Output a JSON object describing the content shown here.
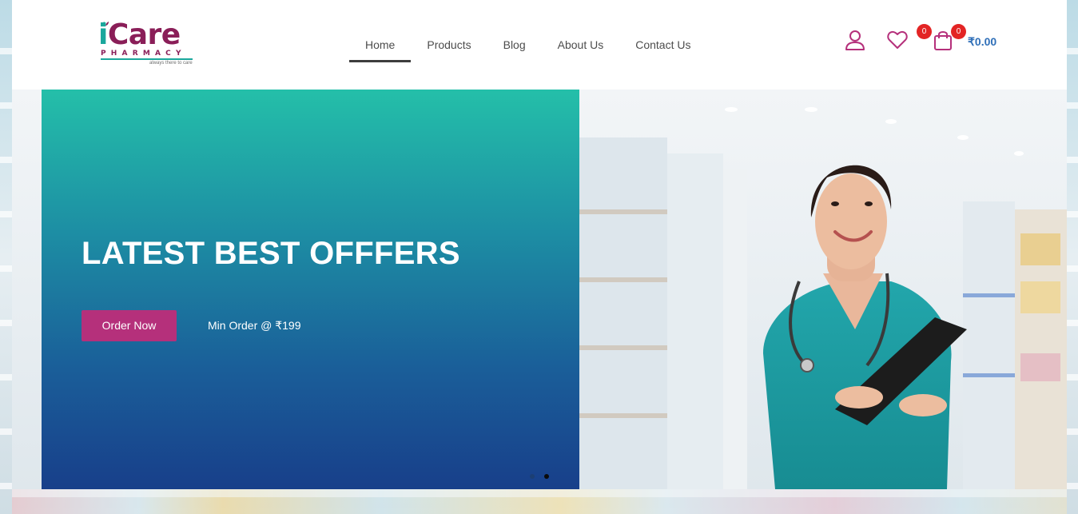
{
  "brand": {
    "name_part1": "i",
    "name_part2": "Care",
    "subtitle": "PHARMACY",
    "tagline": "always there to care"
  },
  "nav": {
    "items": [
      {
        "label": "Home",
        "active": true
      },
      {
        "label": "Products",
        "active": false
      },
      {
        "label": "Blog",
        "active": false
      },
      {
        "label": "About Us",
        "active": false
      },
      {
        "label": "Contact Us",
        "active": false
      }
    ]
  },
  "header_actions": {
    "account_icon": "user-icon",
    "wishlist_icon": "heart-icon",
    "wishlist_count": "0",
    "cart_icon": "shopping-bag-icon",
    "cart_count": "0",
    "cart_total": "₹0.00"
  },
  "hero": {
    "title": "LATEST BEST OFFFERS",
    "cta_label": "Order Now",
    "min_order_text": "Min Order @ ₹199",
    "slides_total": 2,
    "active_slide": 2
  },
  "colors": {
    "brand_teal": "#1aa79c",
    "brand_magenta": "#8a1e58",
    "cta": "#b5307b",
    "badge": "#e32424",
    "cart_total": "#2f6fb8"
  }
}
